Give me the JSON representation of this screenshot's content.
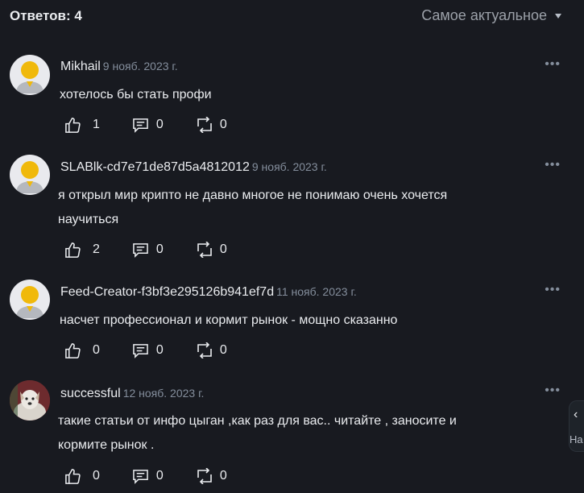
{
  "header": {
    "replies_label": "Ответов: 4",
    "sort_label": "Самое актуальное"
  },
  "comments": [
    {
      "name": "Mikhail",
      "date": "9 нояб. 2023 г.",
      "text": "хотелось бы стать профи",
      "likes": "1",
      "comments": "0",
      "reposts": "0",
      "avatar": "default-avatar"
    },
    {
      "name": "SLABlk-cd7e71de87d5a4812012",
      "date": "9 нояб. 2023 г.",
      "text": "я открыл мир крипто не давно многое не понимаю очень хочется научиться",
      "likes": "2",
      "comments": "0",
      "reposts": "0",
      "avatar": "default-avatar"
    },
    {
      "name": "Feed-Creator-f3bf3e295126b941ef7d",
      "date": "11 нояб. 2023 г.",
      "text": "насчет профессионал и кормит рынок - мощно сказанно",
      "likes": "0",
      "comments": "0",
      "reposts": "0",
      "avatar": "default-avatar"
    },
    {
      "name": "successful",
      "date": "12 нояб. 2023 г.",
      "text": "такие статьи от инфо цыган ,как раз для вас.. читайте , заносите и кормите рынок .",
      "likes": "0",
      "comments": "0",
      "reposts": "0",
      "avatar": "dog-photo"
    }
  ],
  "side_widget": {
    "label": "На"
  },
  "colors": {
    "background": "#181a20",
    "text": "#eaecef",
    "muted": "#848e9c",
    "accent": "#f0b90b"
  },
  "icons": {
    "like": "thumbs-up-icon",
    "comment": "comment-icon",
    "repost": "repost-icon",
    "more": "more-icon"
  }
}
